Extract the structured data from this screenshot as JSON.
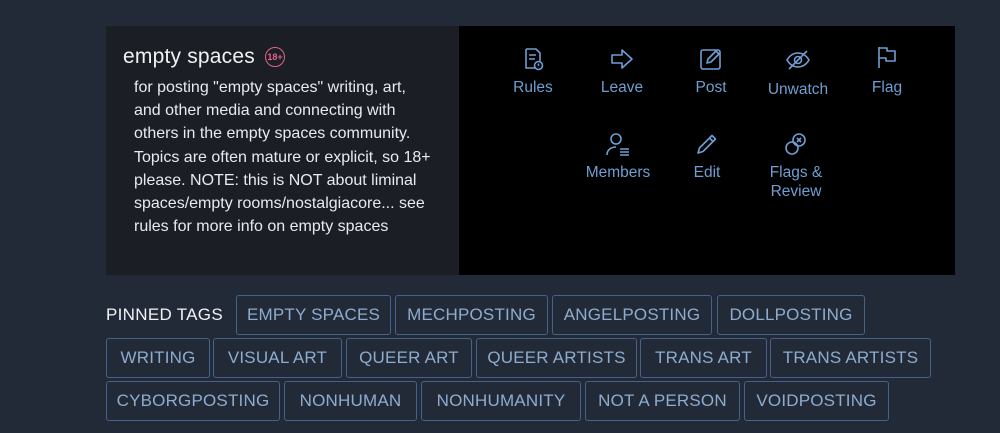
{
  "community": {
    "title": "empty spaces",
    "badge": "18+",
    "description": "for posting \"empty spaces\" writing, art, and other media and connecting with others in the empty spaces community. Topics are often mature or explicit, so 18+ please. NOTE: this is NOT about liminal spaces/empty rooms/nostalgiacore... see rules for more info on empty spaces"
  },
  "actions": [
    {
      "label": "Rules",
      "icon": "rules-icon"
    },
    {
      "label": "Leave",
      "icon": "leave-arrow-icon"
    },
    {
      "label": "Post",
      "icon": "post-edit-icon"
    },
    {
      "label": "Unwatch",
      "icon": "eye-slash-icon"
    },
    {
      "label": "Flag",
      "icon": "flag-icon"
    },
    {
      "label": "Members",
      "icon": "members-icon"
    },
    {
      "label": "Edit",
      "icon": "pencil-icon"
    },
    {
      "label": "Flags & Review",
      "icon": "flags-review-icon"
    }
  ],
  "pinned_tags": {
    "label": "PINNED TAGS",
    "tags": [
      "EMPTY SPACES",
      "MECHPOSTING",
      "ANGELPOSTING",
      "DOLLPOSTING",
      "WRITING",
      "VISUAL ART",
      "QUEER ART",
      "QUEER ARTISTS",
      "TRANS ART",
      "TRANS ARTISTS",
      "CYBORGPOSTING",
      "NONHUMAN",
      "NONHUMANITY",
      "NOT A PERSON",
      "VOIDPOSTING"
    ]
  },
  "colors": {
    "background": "#232a37",
    "info_panel": "#1b1e25",
    "actions_panel": "#000000",
    "action_blue": "#6f9ed1",
    "tag_border": "#46618a",
    "tag_text": "#8eacce",
    "badge_pink": "#e2628a"
  }
}
